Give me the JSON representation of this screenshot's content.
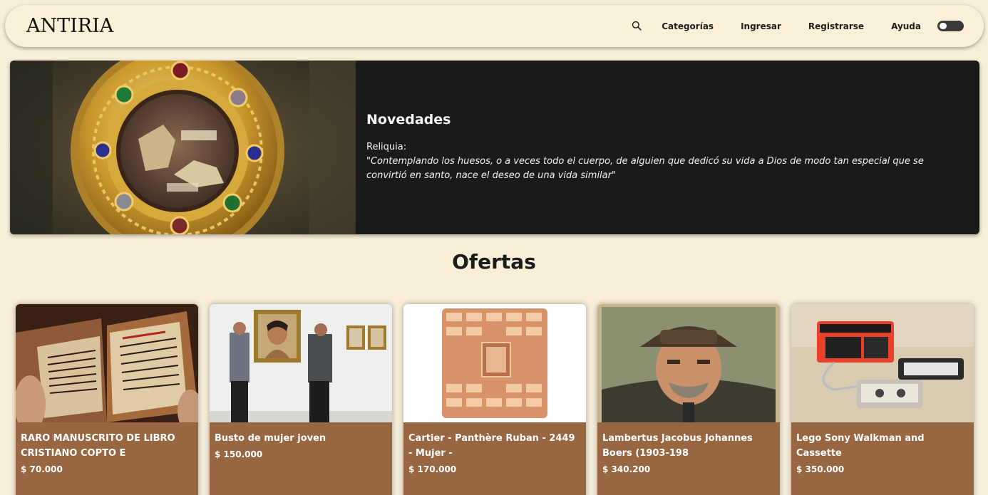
{
  "nav": {
    "logo": "ANTIRIA",
    "links": [
      "Categorías",
      "Ingresar",
      "Registrarse",
      "Ayuda"
    ]
  },
  "hero": {
    "title": "Novedades",
    "subtitle": "Reliquia:",
    "quote": "\"Contemplando los huesos, o a veces todo el cuerpo, de alguien que dedicó su vida a Dios de modo tan especial que se convirtió en santo, nace el deseo de una vida similar\""
  },
  "ofertas": {
    "title": "Ofertas",
    "items": [
      {
        "title": "RARO MANUSCRITO DE LIBRO CRISTIANO COPTO E",
        "price": "$ 70.000"
      },
      {
        "title": "Busto de mujer joven",
        "price": "$ 150.000"
      },
      {
        "title": "Cartier - Panthère Ruban - 2449 - Mujer -",
        "price": "$ 170.000"
      },
      {
        "title": "Lambertus Jacobus Johannes Boers (1903-198",
        "price": "$ 340.200"
      },
      {
        "title": "Lego Sony Walkman and Cassette",
        "price": "$ 350.000"
      }
    ]
  },
  "colors": {
    "background": "#f8efd9",
    "navbar": "#faf0d7",
    "hero": "#1b1a1a",
    "card": "#986640"
  }
}
